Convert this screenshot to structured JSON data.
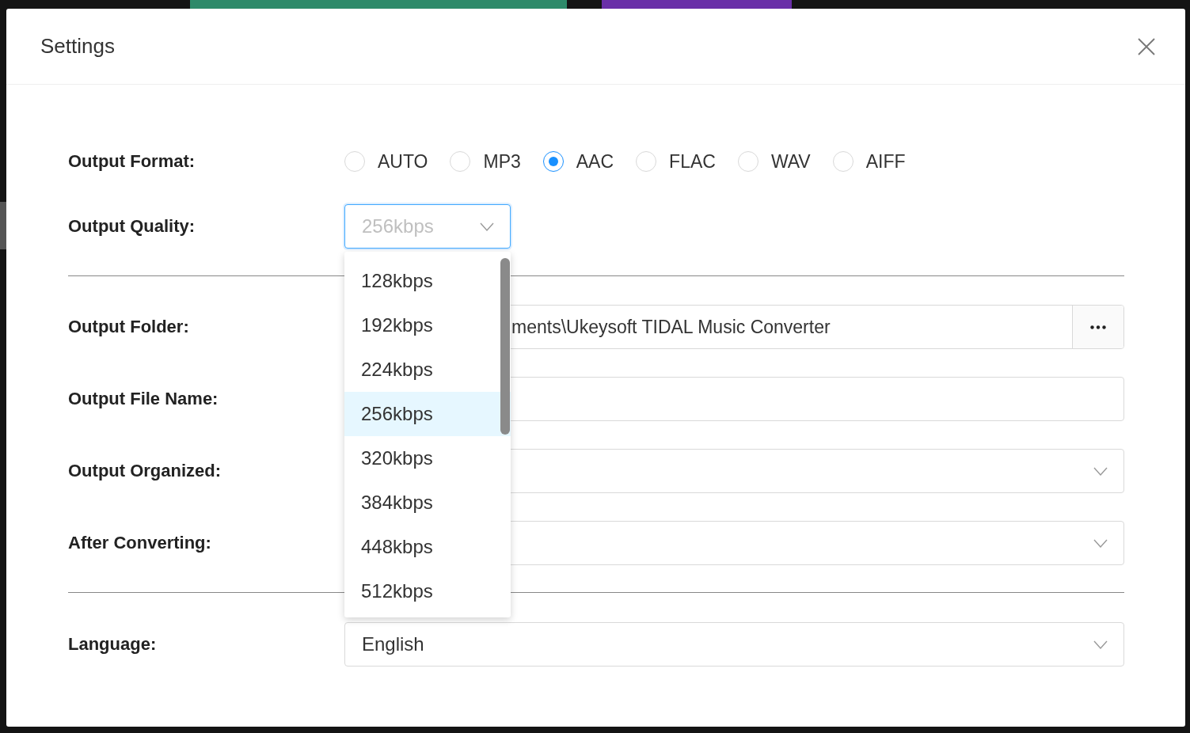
{
  "dialog": {
    "title": "Settings"
  },
  "output_format": {
    "label": "Output Format:",
    "options": [
      {
        "label": "AUTO",
        "selected": false
      },
      {
        "label": "MP3",
        "selected": false
      },
      {
        "label": "AAC",
        "selected": true
      },
      {
        "label": "FLAC",
        "selected": false
      },
      {
        "label": "WAV",
        "selected": false
      },
      {
        "label": "AIFF",
        "selected": false
      }
    ]
  },
  "output_quality": {
    "label": "Output Quality:",
    "value": "256kbps",
    "expanded": true,
    "options": [
      {
        "label": "128kbps",
        "selected": false
      },
      {
        "label": "192kbps",
        "selected": false
      },
      {
        "label": "224kbps",
        "selected": false
      },
      {
        "label": "256kbps",
        "selected": true
      },
      {
        "label": "320kbps",
        "selected": false
      },
      {
        "label": "384kbps",
        "selected": false
      },
      {
        "label": "448kbps",
        "selected": false
      },
      {
        "label": "512kbps",
        "selected": false
      }
    ]
  },
  "output_folder": {
    "label": "Output Folder:",
    "value": "ments\\Ukeysoft TIDAL Music Converter"
  },
  "output_file_name": {
    "label": "Output File Name:"
  },
  "output_organized": {
    "label": "Output Organized:"
  },
  "after_converting": {
    "label": "After Converting:"
  },
  "language": {
    "label": "Language:",
    "value": "English"
  }
}
